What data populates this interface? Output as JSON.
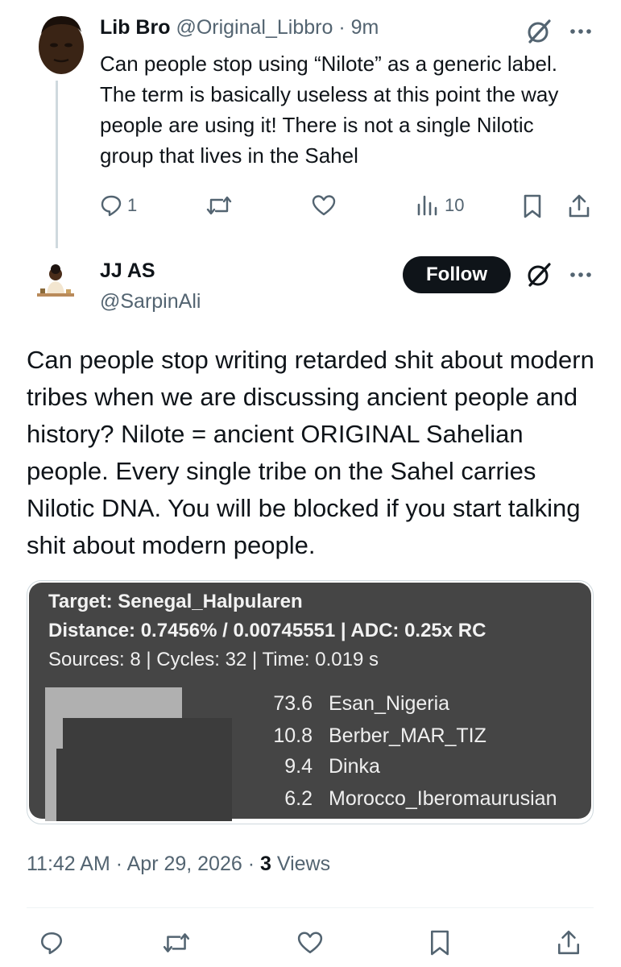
{
  "tweet1": {
    "display_name": "Lib Bro",
    "handle": "@Original_Libbro",
    "separator": "·",
    "time": "9m",
    "text": "Can people stop using “Nilote” as a generic label. The term is basically useless at this point the way people are using it! There is not a single Nilotic group that lives in the Sahel",
    "reply_count": "1",
    "views_count": "10"
  },
  "tweet2": {
    "display_name": "JJ AS",
    "handle": "@SarpinAli",
    "follow_label": "Follow",
    "text": "Can people stop writing retarded shit about modern tribes when we are discussing ancient people and history? Nilote = ancient ORIGINAL Sahelian people. Every single tribe on the Sahel carries Nilotic DNA.  You will be blocked if you start talking shit about modern people.",
    "timestamp": "11:42 AM · Apr 29, 2026 · ",
    "views_count": "3",
    "views_label": " Views"
  },
  "image_card": {
    "line1": "Target: Senegal_Halpularen",
    "line2": "Distance: 0.7456% / 0.00745551 | ADC: 0.25x RC",
    "line3": "Sources: 8 | Cycles: 32 | Time: 0.019 s",
    "results": [
      {
        "pct": "73.6",
        "label": "Esan_Nigeria"
      },
      {
        "pct": "10.8",
        "label": "Berber_MAR_TIZ"
      },
      {
        "pct": "9.4",
        "label": "Dinka"
      },
      {
        "pct": "6.2",
        "label": "Morocco_Iberomaurusian"
      }
    ],
    "bar_colors": {
      "light": "#b0b0b0",
      "dark": "#3c3c3c"
    }
  },
  "icons": [
    "reply-icon",
    "retweet-icon",
    "like-icon",
    "views-icon",
    "bookmark-icon",
    "share-icon",
    "grok-icon",
    "more-icon"
  ]
}
